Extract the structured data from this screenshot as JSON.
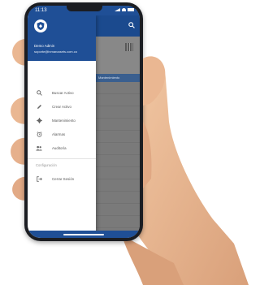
{
  "status_bar": {
    "time": "11:13"
  },
  "drawer": {
    "user_name": "Demo Admin",
    "user_email": "soporte@inmarcasets.com.co",
    "menu_items": [
      {
        "label": "Buscar Activo",
        "icon": "search-icon"
      },
      {
        "label": "Crear Activo",
        "icon": "pencil-icon"
      },
      {
        "label": "Mantenimiento",
        "icon": "gear-icon"
      },
      {
        "label": "Alarmas",
        "icon": "alarm-clock-icon"
      },
      {
        "label": "Auditoría",
        "icon": "users-icon"
      }
    ],
    "section_label": "Configuración",
    "logout_label": "Cerrar Sesión",
    "logout_icon": "logout-icon"
  },
  "background_app": {
    "band_text": "Mantenimiento"
  },
  "colors": {
    "brand": "#1f4f96",
    "scrim": "#7a7a7a",
    "hand": "#e7b590"
  }
}
